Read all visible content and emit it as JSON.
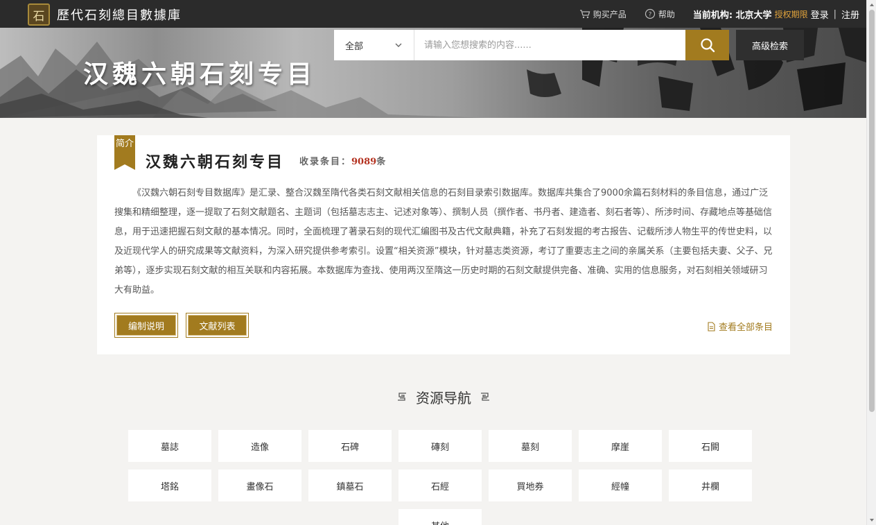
{
  "header": {
    "logo_char": "石",
    "site_title": "歷代石刻總目數據庫",
    "buy_label": "购买产品",
    "help_label": "帮助",
    "org_label": "当前机构: 北京大学",
    "auth_label": "授权期限",
    "login_label": "登录",
    "separator": "|",
    "register_label": "注册"
  },
  "banner": {
    "title": "汉魏六朝石刻专目",
    "search": {
      "scope_value": "全部",
      "placeholder": "请输入您想搜索的内容......"
    },
    "advanced_label": "高级检索"
  },
  "intro": {
    "tag": "简介",
    "title": "汉魏六朝石刻专目",
    "count_prefix": "收录条目：",
    "count_value": "9089",
    "count_suffix": "条",
    "description": "《汉魏六朝石刻专目数据库》是汇录、整合汉魏至隋代各类石刻文献相关信息的石刻目录索引数据库。数据库共集合了9000余篇石刻材料的条目信息，通过广泛搜集和精细整理，逐一提取了石刻文献题名、主题词（包括墓志志主、记述对象等）、撰制人员（撰作者、书丹者、建造者、刻石者等）、所涉时间、存藏地点等基础信息，用于迅速把握石刻文献的基本情况。同时，全面梳理了著录石刻的现代汇编图书及古代文献典籍，补充了石刻发掘的考古报告、记载所涉人物生平的传世史料，以及近现代学人的研究成果等文献资料，为深入研究提供参考索引。设置“相关资源”模块，针对墓志类资源，考订了重要志主之间的亲属关系（主要包括夫妻、父子、兄弟等），逐步实现石刻文献的相互关联和内容拓展。本数据库为查找、使用两汉至隋这一历史时期的石刻文献提供完备、准确、实用的信息服务，对石刻相关领域研习大有助益。",
    "btn_editing": "编制说明",
    "btn_literature": "文献列表",
    "view_all_label": "查看全部条目"
  },
  "resource_nav": {
    "title": "资源导航",
    "items": [
      "墓誌",
      "造像",
      "石碑",
      "磚刻",
      "墓刻",
      "摩崖",
      "石闕",
      "塔銘",
      "畫像石",
      "鎮墓石",
      "石經",
      "買地券",
      "經幢",
      "井欄",
      "其他"
    ]
  },
  "colors": {
    "accent": "#a27b1f",
    "topbar": "#2b2b2b",
    "auth": "#e1a33b",
    "count": "#b3301e"
  }
}
